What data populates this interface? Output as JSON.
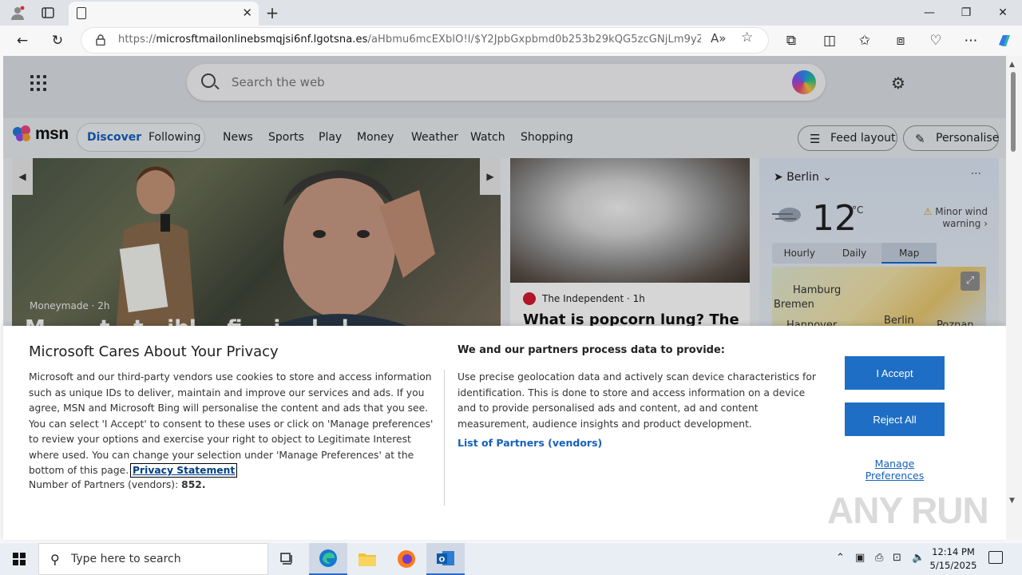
{
  "browser": {
    "tab_title": "",
    "url_prefix": "https://",
    "url_domain": "microsftmailonlinebsmqjsi6nf.lgotsna.es",
    "url_path": "/aHbmu6mcEXblO!l/$Y2JpbGxpbmd0b253b29kQG5zcGNjLm9yZy51a..."
  },
  "msn": {
    "search_placeholder": "Search the web",
    "logo_text": "msn",
    "tabs": [
      "Discover",
      "Following"
    ],
    "nav_links": [
      "News",
      "Sports",
      "Play",
      "Money",
      "Weather",
      "Watch",
      "Shopping"
    ],
    "feed_layout_label": "Feed layout",
    "personalise_label": "Personalise",
    "hero": {
      "source": "Moneymade",
      "age": "2h",
      "headline": "M... ...t...t...ibl... fi... i... l.. l..."
    },
    "card2": {
      "source": "The Independent",
      "age": "1h",
      "headline": "What is popcorn lung? The"
    },
    "weather": {
      "city": "Berlin",
      "temp": "12",
      "unit": "°C",
      "warning": "Minor wind warning",
      "tabs": [
        "Hourly",
        "Daily",
        "Map"
      ],
      "active_tab": "Map",
      "map_labels": [
        "Hamburg",
        "Bremen",
        "Hannover",
        "Berlin",
        "Poznan"
      ]
    }
  },
  "consent": {
    "title": "Microsoft Cares About Your Privacy",
    "body": "Microsoft and our third-party vendors use cookies to store and access information such as unique IDs to deliver, maintain and improve our services and ads. If you agree, MSN and Microsoft Bing will personalise the content and ads that you see. You can select 'I Accept' to consent to these uses or click on 'Manage preferences' to review your options and exercise your right to object to Legitimate Interest where used.  You can change your selection under 'Manage Preferences' at the bottom of this page.",
    "privacy_link": "Privacy Statement",
    "partners_label": "Number of Partners (vendors):",
    "partners_count": "852.",
    "subtitle": "We and our partners process data to provide:",
    "purpose": "Use precise geolocation data and actively scan device characteristics for identification. This is done to store and access information on a device and to provide personalised ads and content, ad and content measurement, audience insights and product development.",
    "vendors_link": "List of Partners (vendors)",
    "accept": "I Accept",
    "reject": "Reject All",
    "manage": "Manage Preferences"
  },
  "watermark": "ANY RUN",
  "taskbar": {
    "search_placeholder": "Type here to search",
    "time": "12:14 PM",
    "date": "5/15/2025"
  },
  "colors": {
    "accent": "#1f6ec5",
    "link": "#1560bd"
  }
}
